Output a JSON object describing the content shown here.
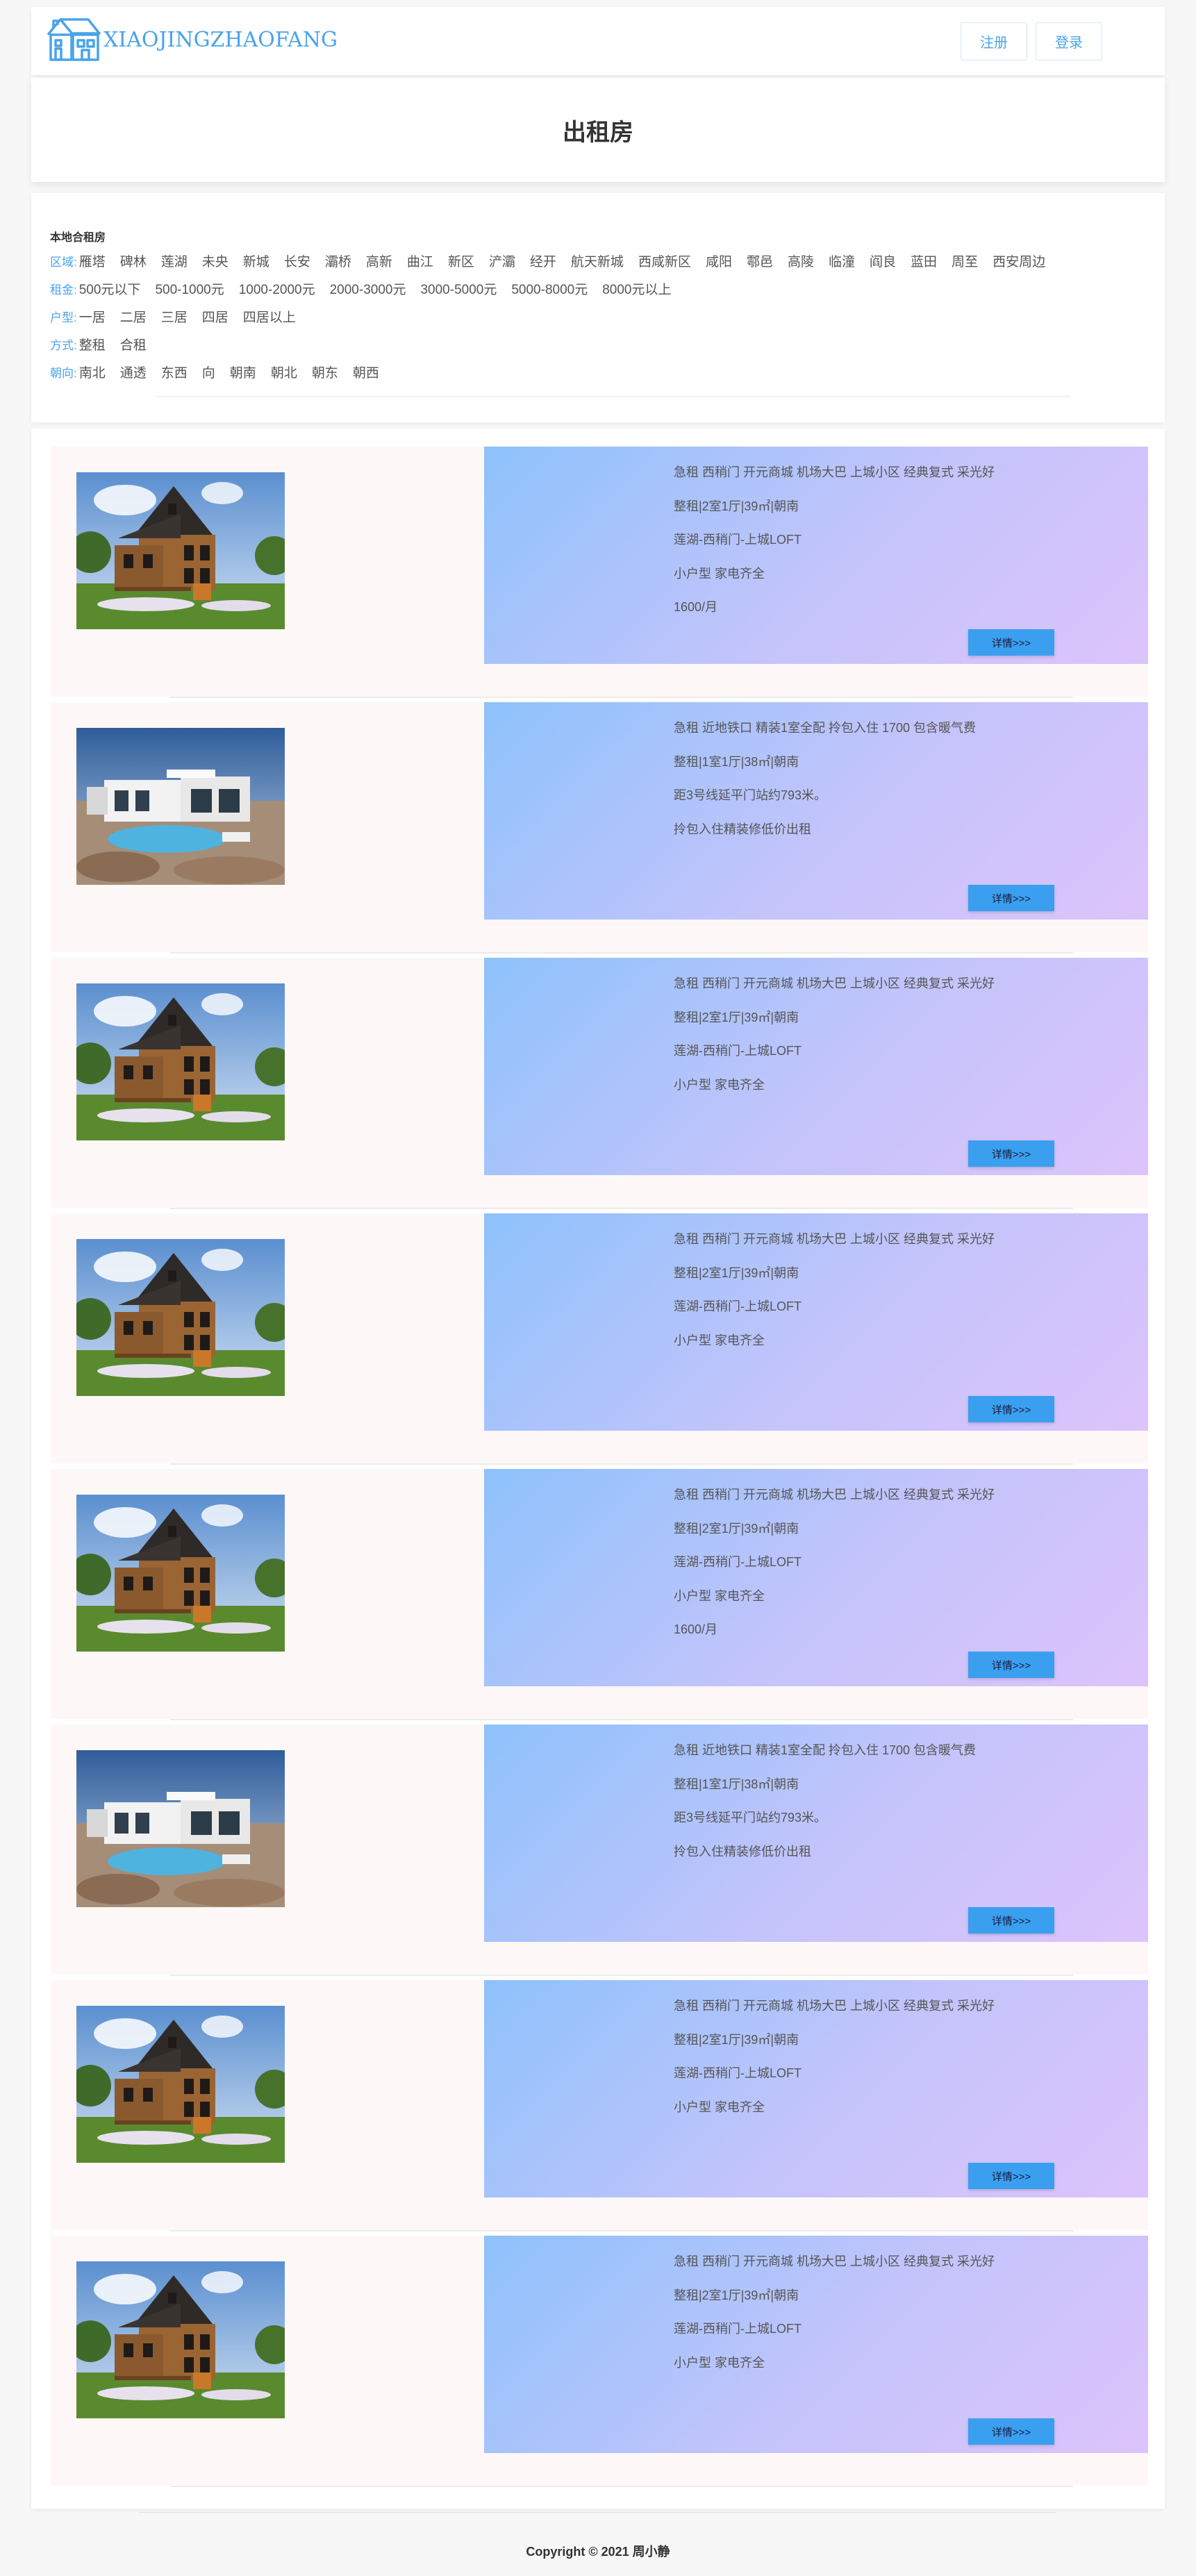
{
  "header": {
    "logo_text": "XIAOJINGZHAOFANG",
    "register_label": "注册",
    "login_label": "登录"
  },
  "page": {
    "title": "出租房"
  },
  "filters": {
    "heading": "本地合租房",
    "rows": [
      {
        "label": "区域:",
        "options": [
          "雁塔",
          "碑林",
          "莲湖",
          "未央",
          "新城",
          "长安",
          "灞桥",
          "高新",
          "曲江",
          "新区",
          "浐灞",
          "经开",
          "航天新城",
          "西咸新区",
          "咸阳",
          "鄠邑",
          "高陵",
          "临潼",
          "阎良",
          "蓝田",
          "周至",
          "西安周边"
        ]
      },
      {
        "label": "租金:",
        "options": [
          "500元以下",
          "500-1000元",
          "1000-2000元",
          "2000-3000元",
          "3000-5000元",
          "5000-8000元",
          "8000元以上"
        ]
      },
      {
        "label": "户型:",
        "options": [
          "一居",
          "二居",
          "三居",
          "四居",
          "四居以上"
        ]
      },
      {
        "label": "方式:",
        "options": [
          "整租",
          "合租"
        ]
      },
      {
        "label": "朝向:",
        "options": [
          "南北",
          "通透",
          "东西",
          "向",
          "朝南",
          "朝北",
          "朝东",
          "朝西"
        ]
      }
    ]
  },
  "listings": [
    {
      "image": "wooden-house",
      "lines": [
        "急租 西稍门 开元商城 机场大巴 上城小区 经典复式 采光好",
        "整租|2室1厅|39㎡|朝南",
        "莲湖-西稍门-上城LOFT",
        "小户型 家电齐全",
        "1600/月"
      ],
      "detail_label": "详情>>>"
    },
    {
      "image": "villa-pool",
      "lines": [
        "急租 近地铁口 精装1室全配 拎包入住 1700 包含暖气费",
        "整租|1室1厅|38㎡|朝南",
        "距3号线延平门站约793米。",
        "拎包入住精装修低价出租"
      ],
      "detail_label": "详情>>>"
    },
    {
      "image": "wooden-house",
      "lines": [
        "急租 西稍门 开元商城 机场大巴 上城小区 经典复式 采光好",
        "整租|2室1厅|39㎡|朝南",
        "莲湖-西稍门-上城LOFT",
        "小户型 家电齐全"
      ],
      "detail_label": "详情>>>"
    },
    {
      "image": "wooden-house",
      "lines": [
        "急租 西稍门 开元商城 机场大巴 上城小区 经典复式 采光好",
        "整租|2室1厅|39㎡|朝南",
        "莲湖-西稍门-上城LOFT",
        "小户型 家电齐全"
      ],
      "detail_label": "详情>>>"
    },
    {
      "image": "wooden-house",
      "lines": [
        "急租 西稍门 开元商城 机场大巴 上城小区 经典复式 采光好",
        "整租|2室1厅|39㎡|朝南",
        "莲湖-西稍门-上城LOFT",
        "小户型 家电齐全",
        "1600/月"
      ],
      "detail_label": "详情>>>"
    },
    {
      "image": "villa-pool",
      "lines": [
        "急租 近地铁口 精装1室全配 拎包入住 1700 包含暖气费",
        "整租|1室1厅|38㎡|朝南",
        "距3号线延平门站约793米。",
        "拎包入住精装修低价出租"
      ],
      "detail_label": "详情>>>"
    },
    {
      "image": "wooden-house",
      "lines": [
        "急租 西稍门 开元商城 机场大巴 上城小区 经典复式 采光好",
        "整租|2室1厅|39㎡|朝南",
        "莲湖-西稍门-上城LOFT",
        "小户型 家电齐全"
      ],
      "detail_label": "详情>>>"
    },
    {
      "image": "wooden-house",
      "lines": [
        "急租 西稍门 开元商城 机场大巴 上城小区 经典复式 采光好",
        "整租|2室1厅|39㎡|朝南",
        "莲湖-西稍门-上城LOFT",
        "小户型 家电齐全"
      ],
      "detail_label": "详情>>>"
    }
  ],
  "footer": {
    "copyright": "Copyright © 2021 周小静"
  }
}
